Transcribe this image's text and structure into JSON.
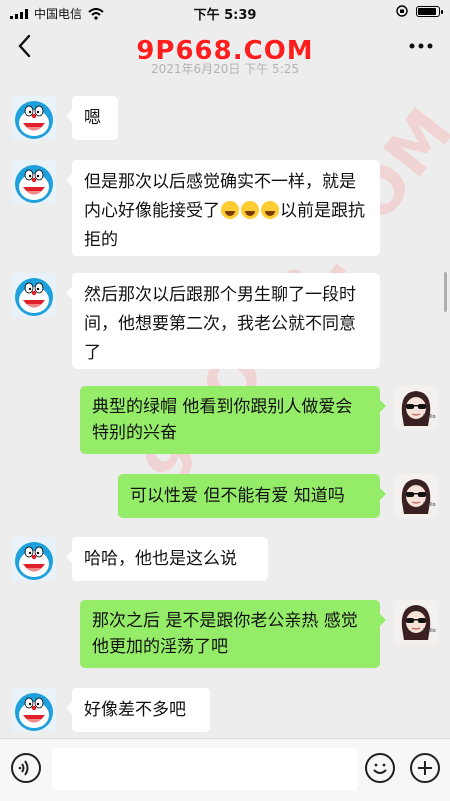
{
  "statusbar": {
    "carrier": "中国电信",
    "time": "下午 5:39",
    "battery_level": 0.92
  },
  "header": {
    "watermark_title": "9P668.COM",
    "date_stamp": "2021年6月20日 下午 5:25"
  },
  "watermark_diagonal": "9POOR.COM",
  "messages": [
    {
      "side": "left",
      "text": "嗯"
    },
    {
      "side": "left",
      "text_before": "但是那次以后感觉确实不一样，就是内心好像能接受了",
      "emoji_count": 3,
      "text_after": "以前是跟抗拒的"
    },
    {
      "side": "left",
      "text": "然后那次以后跟那个男生聊了一段时间，他想要第二次，我老公就不同意了"
    },
    {
      "side": "right",
      "text": "典型的绿帽 他看到你跟别人做爱会特别的兴奋"
    },
    {
      "side": "right",
      "text": "可以性爱 但不能有爱 知道吗"
    },
    {
      "side": "left",
      "text": "哈哈，他也是这么说"
    },
    {
      "side": "right",
      "text": "那次之后 是不是跟你老公亲热 感觉他更加的淫荡了吧"
    },
    {
      "side": "left",
      "text": "好像差不多吧"
    }
  ],
  "icons": {
    "back": "chevron-left-icon",
    "more": "more-dots-icon",
    "voice": "voice-icon",
    "emoji": "emoji-icon",
    "plus": "plus-icon",
    "emoji_inline": "laugh-cry-emoji"
  },
  "colors": {
    "page_bg": "#ededed",
    "self_bubble": "#95ec69",
    "other_bubble": "#ffffff",
    "watermark": "#ff1e1e"
  }
}
